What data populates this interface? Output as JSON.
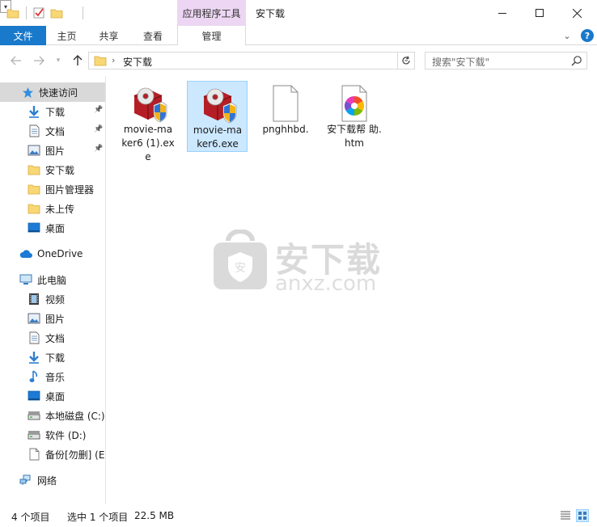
{
  "window": {
    "title": "安下载",
    "context_tab_group": "应用程序工具"
  },
  "ribbon": {
    "file": "文件",
    "home": "主页",
    "share": "共享",
    "view": "查看",
    "manage": "管理"
  },
  "address": {
    "path_label": "安下载",
    "search_placeholder": "搜索\"安下载\""
  },
  "nav": {
    "quick_access": "快速访问",
    "quick_items": [
      {
        "label": "下载",
        "icon": "download-arrow-icon",
        "pinned": true
      },
      {
        "label": "文档",
        "icon": "document-icon",
        "pinned": true
      },
      {
        "label": "图片",
        "icon": "pictures-icon",
        "pinned": true
      },
      {
        "label": "安下载",
        "icon": "folder-icon",
        "pinned": false
      },
      {
        "label": "图片管理器",
        "icon": "folder-icon",
        "pinned": false
      },
      {
        "label": "未上传",
        "icon": "folder-icon",
        "pinned": false
      },
      {
        "label": "桌面",
        "icon": "desktop-icon",
        "pinned": false
      }
    ],
    "onedrive": "OneDrive",
    "this_pc": "此电脑",
    "pc_items": [
      {
        "label": "视频",
        "icon": "video-icon"
      },
      {
        "label": "图片",
        "icon": "pictures-icon"
      },
      {
        "label": "文档",
        "icon": "document-icon"
      },
      {
        "label": "下载",
        "icon": "download-arrow-icon"
      },
      {
        "label": "音乐",
        "icon": "music-note-icon"
      },
      {
        "label": "桌面",
        "icon": "desktop-icon"
      },
      {
        "label": "本地磁盘 (C:)",
        "icon": "drive-icon"
      },
      {
        "label": "软件 (D:)",
        "icon": "drive-icon"
      },
      {
        "label": "备份[勿删] (E:",
        "icon": "blank-file-icon"
      }
    ],
    "network": "网络"
  },
  "files": [
    {
      "name": "movie-maker6 (1).exe",
      "display": "movie-ma ker6 (1).exe",
      "icon": "installer-disc-shield-icon",
      "selected": false
    },
    {
      "name": "movie-maker6.exe",
      "display": "movie-ma ker6.exe",
      "icon": "installer-disc-shield-icon",
      "selected": true
    },
    {
      "name": "pnghhbd.",
      "display": "pnghhbd.",
      "icon": "blank-file-icon",
      "selected": false
    },
    {
      "name": "安下载帮助.htm",
      "display": "安下载帮 助.htm",
      "icon": "html-color-wheel-icon",
      "selected": false
    }
  ],
  "watermark": {
    "text": "安下载",
    "sub": "anxz.com"
  },
  "status": {
    "item_count": "4 个项目",
    "selected": "选中 1 个项目",
    "size": "22.5 MB"
  },
  "colors": {
    "accent": "#1979ca",
    "context_tab": "#ecd6f3",
    "selection": "#cce8ff",
    "folder": "#f8d775"
  }
}
